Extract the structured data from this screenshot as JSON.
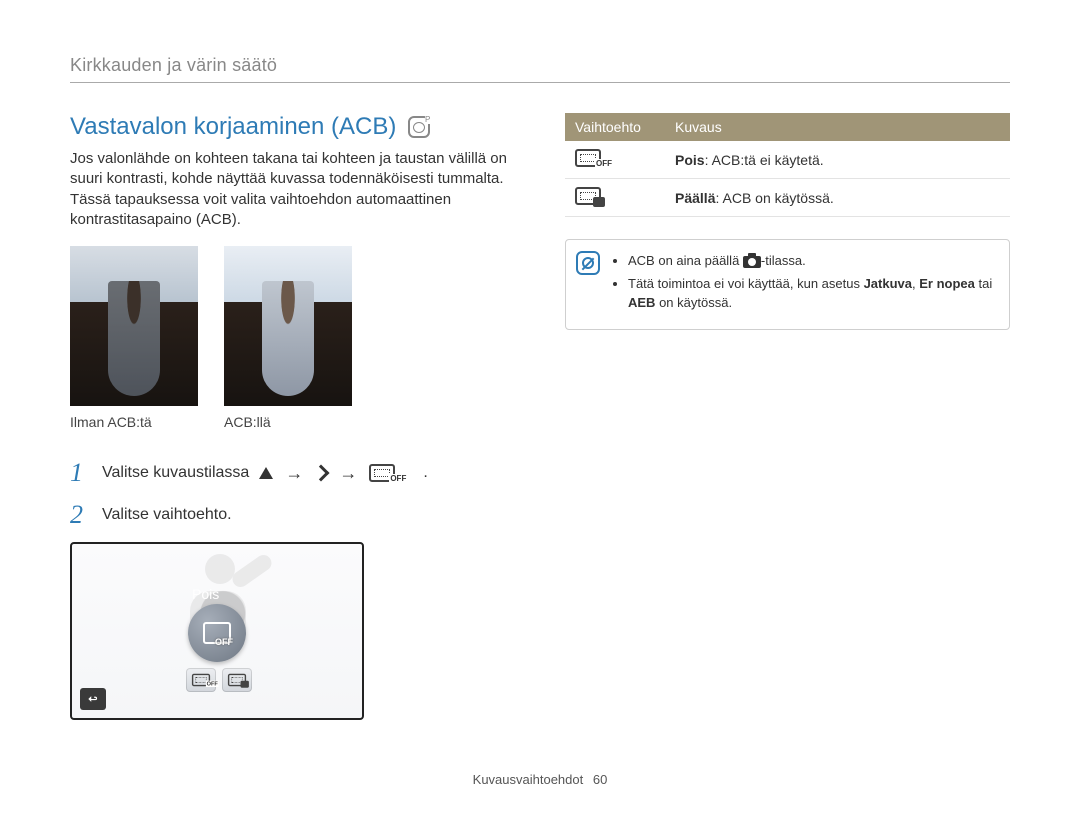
{
  "section_header": "Kirkkauden ja värin säätö",
  "title": "Vastavalon korjaaminen (ACB)",
  "mode_icon_name": "program-mode-icon",
  "intro": "Jos valonlähde on kohteen takana tai kohteen ja taustan välillä on suuri kontrasti, kohde näyttää kuvassa todennäköisesti tummalta. Tässä tapauksessa voit valita vaihtoehdon automaattinen kontrastitasapaino (ACB).",
  "photos": {
    "without_caption": "Ilman ACB:tä",
    "with_caption": "ACB:llä"
  },
  "steps": {
    "one_num": "1",
    "one_text": "Valitse kuvaustilassa",
    "one_end": ".",
    "two_num": "2",
    "two_text": "Valitse vaihtoehto."
  },
  "screen": {
    "selected_label": "Pois"
  },
  "options_table": {
    "header_option": "Vaihtoehto",
    "header_desc": "Kuvaus",
    "rows": [
      {
        "icon": "acb-off",
        "label": "Pois",
        "desc": ": ACB:tä ei käytetä."
      },
      {
        "icon": "acb-on",
        "label": "Päällä",
        "desc": ": ACB on käytössä."
      }
    ]
  },
  "notes": {
    "item1_pre": "ACB on aina päällä ",
    "item1_post": "-tilassa.",
    "item2_pre": "Tätä toimintoa ei voi käyttää, kun asetus ",
    "item2_w1": "Jatkuva",
    "item2_sep1": ", ",
    "item2_w2": "Er nopea",
    "item2_sep2": " tai ",
    "item2_w3": "AEB",
    "item2_post": " on käytössä."
  },
  "footer": {
    "section": "Kuvausvaihtoehdot",
    "page": "60"
  }
}
